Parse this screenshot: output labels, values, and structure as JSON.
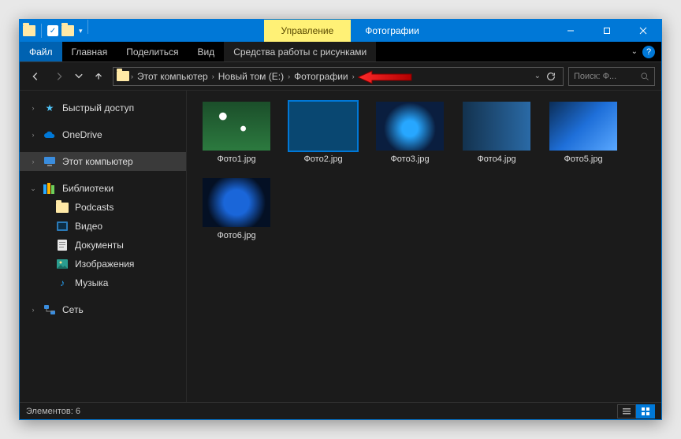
{
  "titlebar": {
    "context_tab": "Управление",
    "title": "Фотографии"
  },
  "ribbon": {
    "file": "Файл",
    "tabs": [
      "Главная",
      "Поделиться",
      "Вид"
    ],
    "context_group": "Средства работы с рисунками"
  },
  "breadcrumbs": [
    "Этот компьютер",
    "Новый том (E:)",
    "Фотографии"
  ],
  "search": {
    "placeholder": "Поиск: Ф..."
  },
  "sidebar": {
    "quick": "Быстрый доступ",
    "onedrive": "OneDrive",
    "thispc": "Этот компьютер",
    "libraries": "Библиотеки",
    "lib_items": [
      "Podcasts",
      "Видео",
      "Документы",
      "Изображения",
      "Музыка"
    ],
    "network": "Сеть"
  },
  "files": [
    {
      "name": "Фото1.jpg",
      "art": "art1"
    },
    {
      "name": "Фото2.jpg",
      "art": "art2"
    },
    {
      "name": "Фото3.jpg",
      "art": "art3"
    },
    {
      "name": "Фото4.jpg",
      "art": "art4"
    },
    {
      "name": "Фото5.jpg",
      "art": "art5"
    },
    {
      "name": "Фото6.jpg",
      "art": "art6"
    }
  ],
  "selected_index": 1,
  "status": {
    "count_label": "Элементов: 6"
  }
}
